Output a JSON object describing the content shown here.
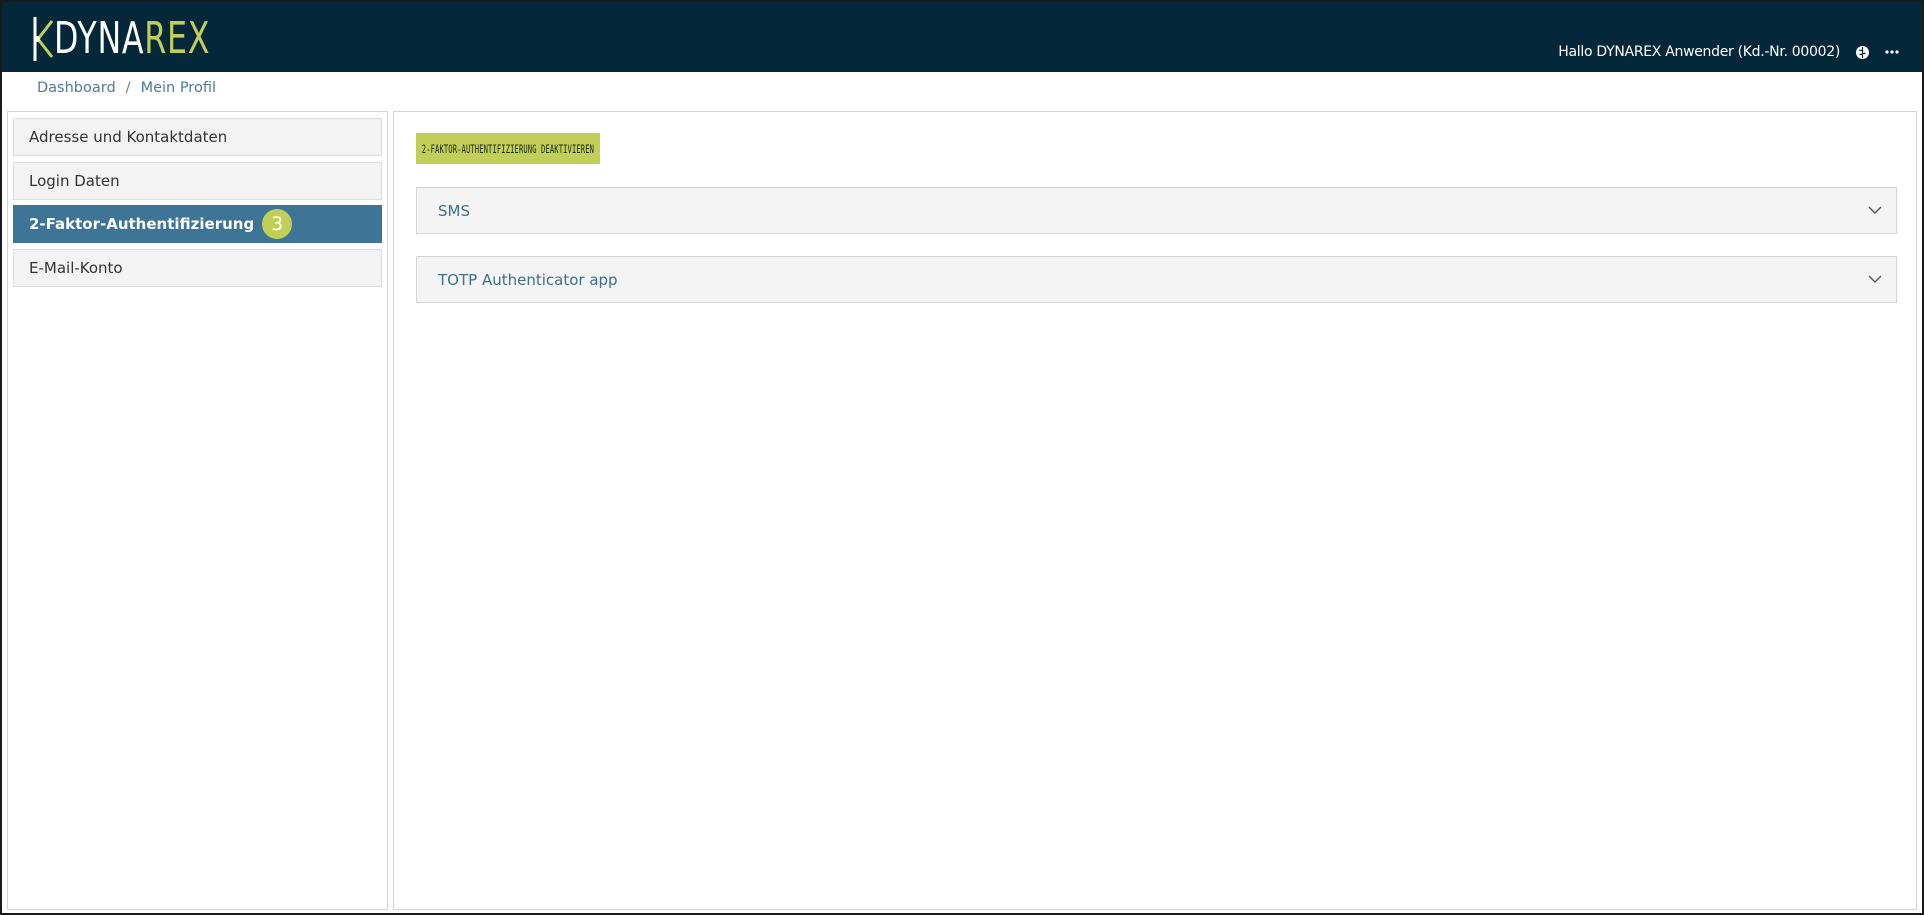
{
  "header": {
    "logo": {
      "part1": "DYNA",
      "part2": "REX"
    },
    "greeting": "Hallo DYNAREX Anwender (Kd.-Nr. 00002)",
    "icons": [
      "brain-icon",
      "more-icon"
    ]
  },
  "breadcrumb": {
    "items": [
      "Dashboard",
      "Mein Profil"
    ],
    "separator": "/"
  },
  "sidebar": {
    "items": [
      {
        "label": "Adresse und Kontaktdaten",
        "active": false
      },
      {
        "label": "Login Daten",
        "active": false
      },
      {
        "label": "2-Faktor-Authentifizierung",
        "active": true,
        "badge": "3"
      },
      {
        "label": "E-Mail-Konto",
        "active": false
      }
    ]
  },
  "main": {
    "deactivate_button": "2-FAKTOR-AUTHENTIFIZIERUNG DEAKTIVIEREN",
    "panels": [
      {
        "title": "SMS",
        "expanded": false
      },
      {
        "title": "TOTP Authenticator app",
        "expanded": false
      }
    ]
  },
  "colors": {
    "header_bg": "#04283a",
    "accent_green": "#c1cf58",
    "active_blue": "#3e7597",
    "link_blue": "#4e7c98"
  }
}
